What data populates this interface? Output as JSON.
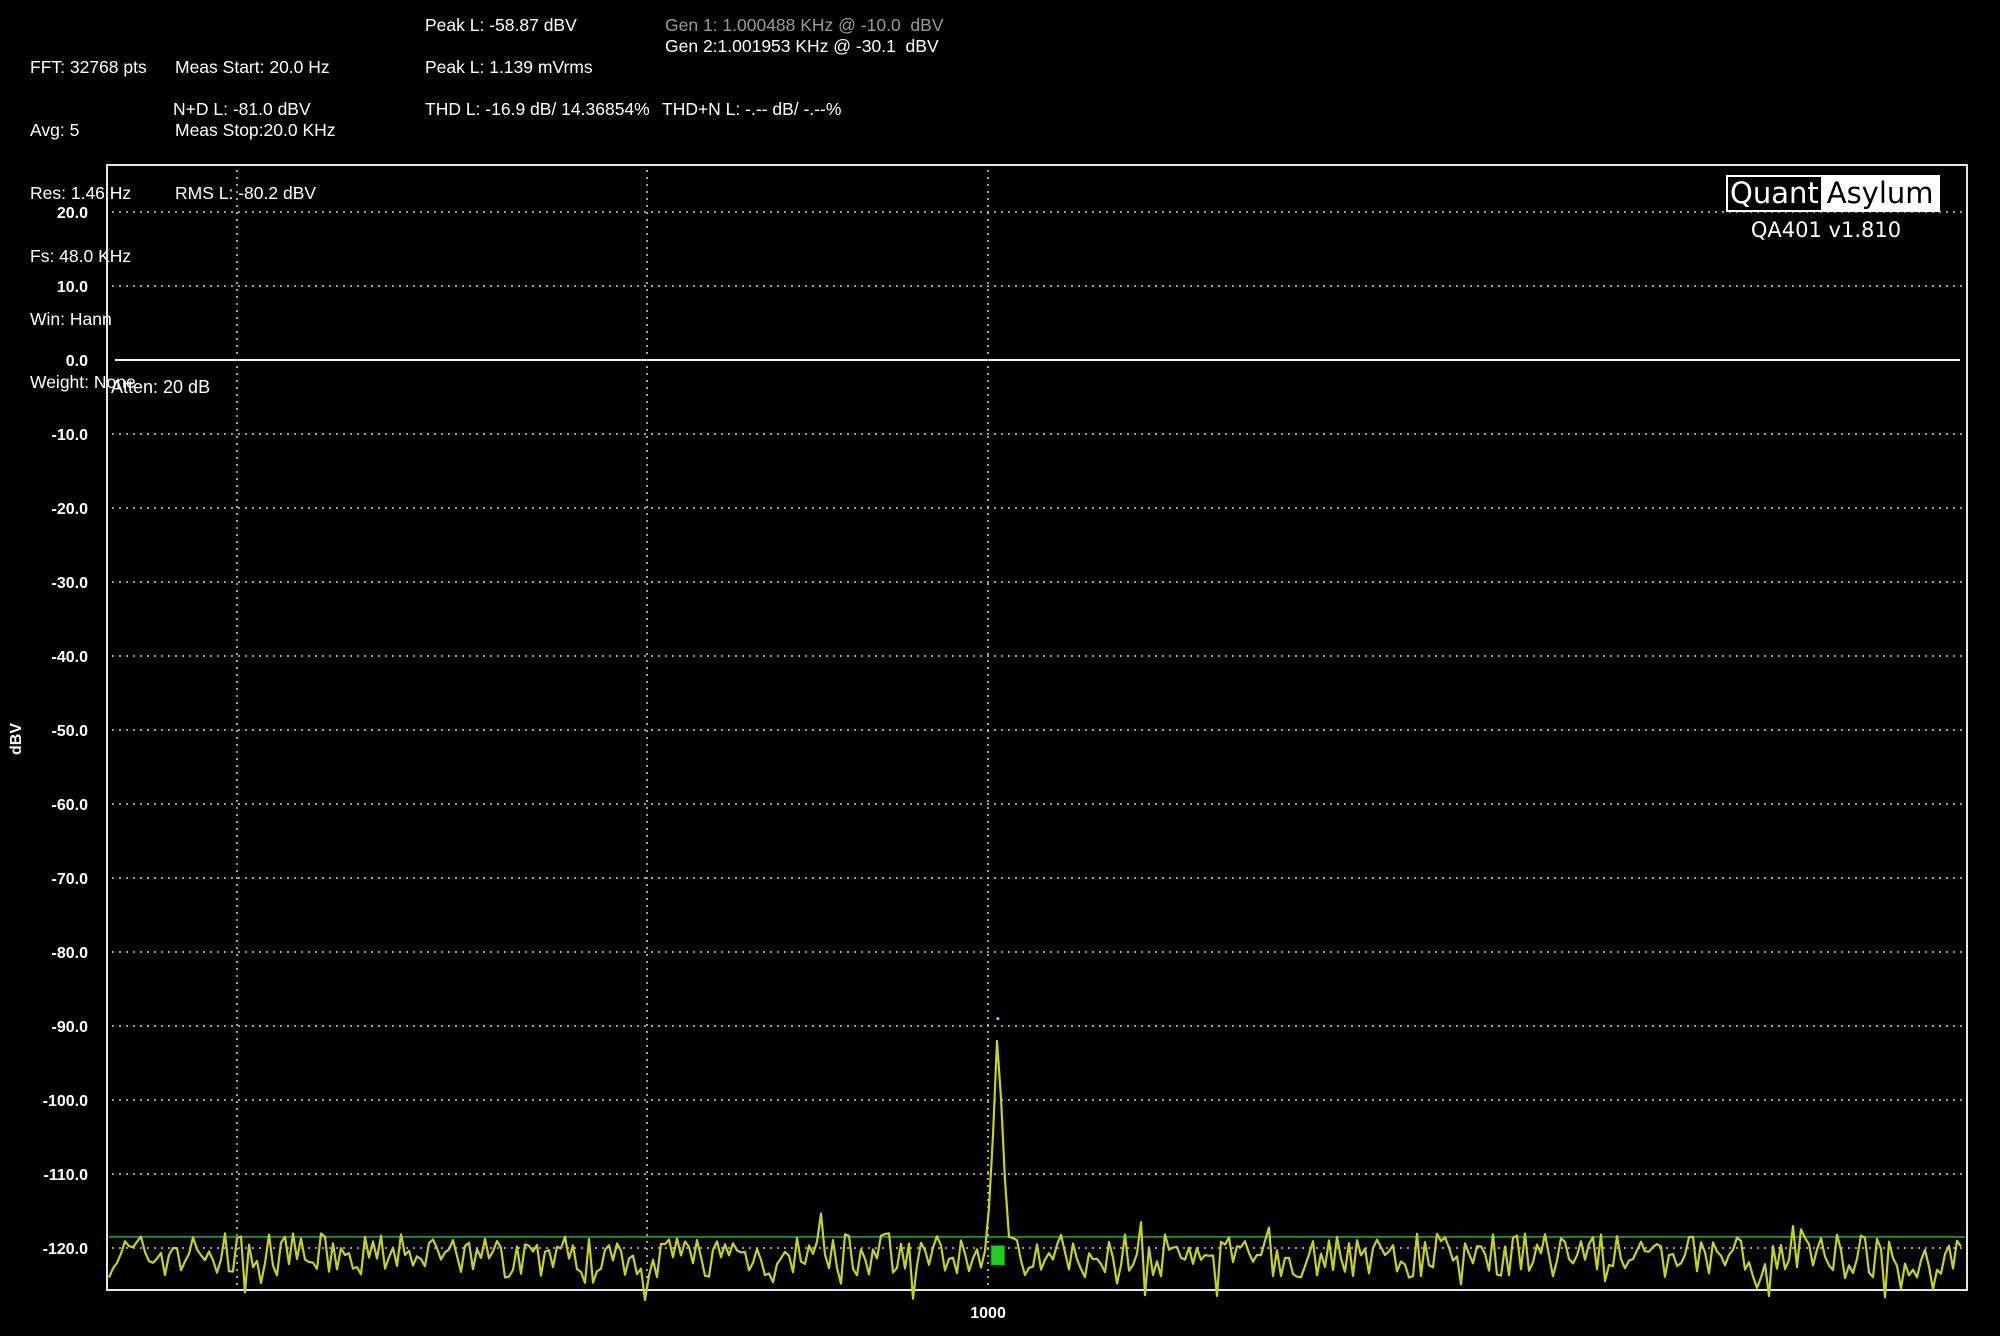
{
  "header": {
    "col1": [
      "FFT: 32768 pts",
      "Avg: 5",
      "Res: 1.46 Hz",
      "Fs: 48.0 KHz",
      "Win: Hann",
      "Weight: None"
    ],
    "meas_start": "Meas Start: 20.0 Hz",
    "meas_stop": "Meas Stop:20.0 KHz",
    "rms_l": "RMS L: -80.2 dBV",
    "nd_l": "N+D L: -81.0 dBV",
    "peak_l_dbv": "Peak L: -58.87 dBV",
    "peak_l_mvrms": "Peak L: 1.139 mVrms",
    "thd_l": "THD L: -16.9 dB/ 14.36854%",
    "thdn_l": "THD+N L: -.-- dB/ -.--%",
    "gen1": "Gen 1: 1.000488 KHz @ -10.0  dBV",
    "gen2": "Gen 2:1.001953 KHz @ -30.1  dBV"
  },
  "logo": {
    "left": "Quant",
    "right": "Asylum"
  },
  "version": "QA401 v1.810",
  "atten": "Atten: 20 dB",
  "colors": {
    "background": "#000000",
    "trace": "#c8d21e",
    "threshold": "#1e8c1e",
    "marker": "#22cc22",
    "grid": "#cccccc"
  },
  "chart_data": {
    "type": "line",
    "ylabel": "dBV",
    "ylim": [
      -125,
      25
    ],
    "yticks": [
      "20.0",
      "10.0",
      "0.0",
      "-10.0",
      "-20.0",
      "-30.0",
      "-40.0",
      "-50.0",
      "-60.0",
      "-70.0",
      "-80.0",
      "-90.0",
      "-100.0",
      "-110.0",
      "-120.0"
    ],
    "ytick_values": [
      20,
      10,
      0,
      -10,
      -20,
      -30,
      -40,
      -50,
      -60,
      -70,
      -80,
      -90,
      -100,
      -110,
      -120
    ],
    "xticks": [
      "1000"
    ],
    "xtick_values": [
      1000
    ],
    "xlim": [
      955,
      1050
    ],
    "reference_line_dbv": 0,
    "threshold_line_dbv": -118.5,
    "series": [
      {
        "peak": {
          "x": 1000.5,
          "y": -89
        },
        "noise_floor_dbv": -121,
        "marker": {
          "x": 1000.5,
          "y": -121
        }
      }
    ]
  }
}
